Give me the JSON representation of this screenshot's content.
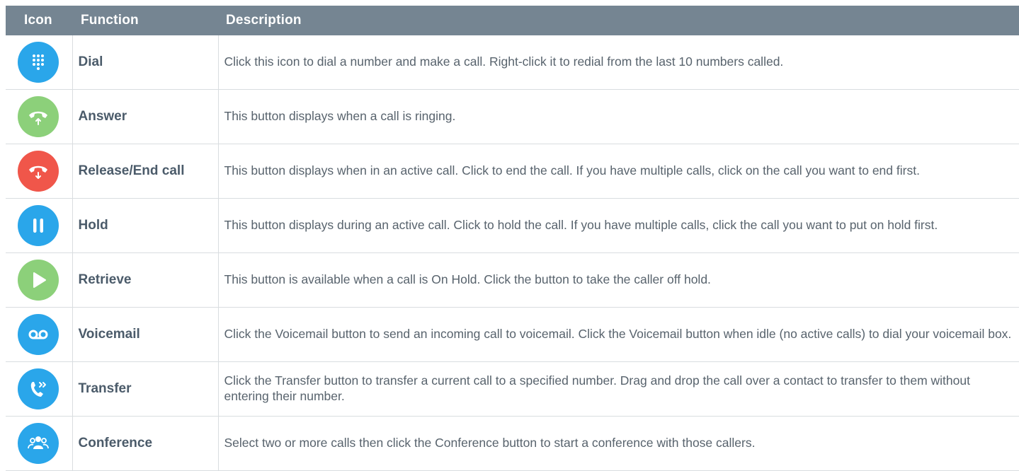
{
  "header": {
    "icon": "Icon",
    "function": "Function",
    "description": "Description"
  },
  "colors": {
    "header_bg": "#758592",
    "blue": "#2aa6ea",
    "green": "#8cd07a",
    "red": "#f0564a"
  },
  "rows": [
    {
      "icon": "dialpad-icon",
      "color": "#2aa6ea",
      "function": "Dial",
      "description": "Click this icon to dial a number and make a call. Right-click it to redial from the last 10 numbers called."
    },
    {
      "icon": "answer-phone-icon",
      "color": "#8cd07a",
      "function": "Answer",
      "description": "This button displays when a call is ringing."
    },
    {
      "icon": "end-call-icon",
      "color": "#f0564a",
      "function": "Release/End call",
      "description": "This button displays when in an active call. Click to end the call. If you have multiple calls, click on the call you want to end first."
    },
    {
      "icon": "pause-icon",
      "color": "#2aa6ea",
      "function": "Hold",
      "description": "This button displays during an active call. Click to hold the call. If you have multiple calls, click the call you want to put on hold first."
    },
    {
      "icon": "play-icon",
      "color": "#8cd07a",
      "function": "Retrieve",
      "description": "This button is available when a call is On Hold. Click the button to take the caller off hold."
    },
    {
      "icon": "voicemail-icon",
      "color": "#2aa6ea",
      "function": "Voicemail",
      "description": "Click the Voicemail button to send an incoming call to voicemail. Click the Voicemail button when idle (no active calls) to dial your voicemail box."
    },
    {
      "icon": "transfer-icon",
      "color": "#2aa6ea",
      "function": "Transfer",
      "description": "Click the Transfer button to transfer a current call to a specified number. Drag and drop the call over a contact to transfer to them without entering their number."
    },
    {
      "icon": "conference-icon",
      "color": "#2aa6ea",
      "function": "Conference",
      "description": "Select two or more calls then click the Conference button to start a conference with those callers."
    }
  ]
}
